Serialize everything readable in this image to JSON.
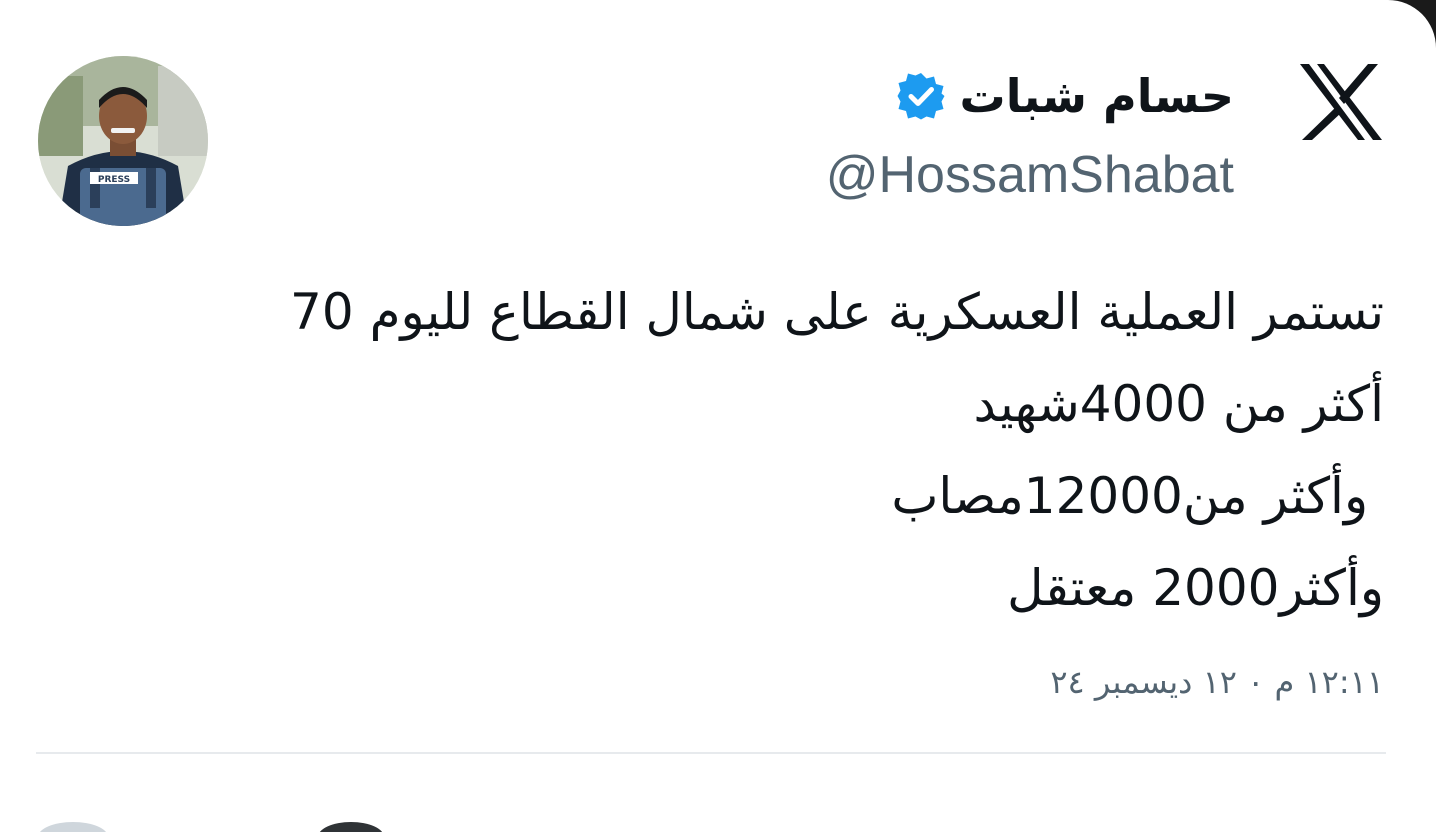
{
  "tweet": {
    "author": {
      "display_name": "حسام شبات",
      "handle": "@HossamShabat",
      "verified": true,
      "avatar_badge": "PRESS"
    },
    "platform_logo": "x-logo-icon",
    "text_lines": [
      "تستمر العملية العسكرية على شمال القطاع لليوم 70",
      "أكثر من 4000شهيد",
      " وأكثر من12000مصاب",
      "وأكثر2000 معتقل"
    ],
    "timestamp": "١٢:١١ م ٠ ١٢ ديسمبر ٢٤"
  },
  "colors": {
    "background": "#ffffff",
    "text_primary": "#0f1419",
    "text_secondary": "#536471",
    "verified_blue": "#1d9bf0",
    "divider": "#e7eaed"
  }
}
